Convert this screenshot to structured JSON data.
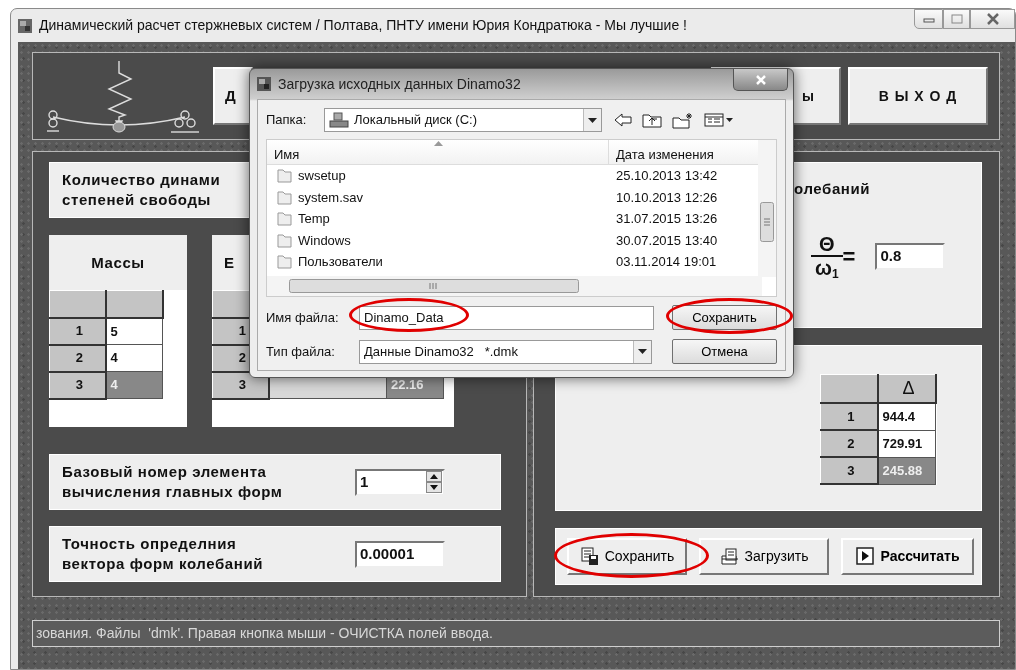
{
  "window": {
    "title": "Динамический расчет стержневых систем / Полтава, ПНТУ имени Юрия Кондратюка - Мы лучшие !"
  },
  "header": {
    "left_button": "Д",
    "middle_button": "ы",
    "exit_button": "В Ы Х О Д"
  },
  "dof": {
    "label_lines": [
      "Количество динами",
      "степеней свободы"
    ]
  },
  "masses": {
    "title": "Массы",
    "rows": [
      {
        "label": "1",
        "value": "5",
        "selected": false
      },
      {
        "label": "2",
        "value": "4",
        "selected": false
      },
      {
        "label": "3",
        "value": "4",
        "selected": true
      }
    ]
  },
  "second_table": {
    "title": "Е",
    "rows": [
      {
        "label": "1"
      },
      {
        "label": "2"
      },
      {
        "label": "3",
        "value": "22.16",
        "selected": true
      }
    ]
  },
  "base_element": {
    "label_lines": [
      "Базовый номер элемента",
      "вычисления главных форм"
    ],
    "value": "1"
  },
  "precision": {
    "label_lines": [
      "Точность определния",
      "вектора форм колебаний"
    ],
    "value": "0.00001"
  },
  "ratio": {
    "title": "олебаний",
    "numerator": "Θ",
    "denominator": "ω",
    "denominator_sub": "1",
    "equals": "=",
    "value": "0.8"
  },
  "deltas": {
    "header": "Δ",
    "rows": [
      {
        "label": "1",
        "value": "944.4",
        "selected": false
      },
      {
        "label": "2",
        "value": "729.91",
        "selected": false
      },
      {
        "label": "3",
        "value": "245.88",
        "selected": true
      }
    ]
  },
  "actions": [
    {
      "kind": "save",
      "label": "Сохранить"
    },
    {
      "kind": "load",
      "label": "Загрузить"
    },
    {
      "kind": "run",
      "label": "Рассчитать"
    }
  ],
  "status_bar": "зования. Файлы  'dmk'. Правая кнопка мыши - ОЧИСТКА полей ввода.",
  "dialog": {
    "title": "Загрузка исходных данных Dinamo32",
    "folder_label": "Папка:",
    "folder": "Локальный диск (C:)",
    "columns": [
      "Имя",
      "Дата изменения"
    ],
    "files": [
      {
        "name": "swsetup",
        "date": "25.10.2013 13:42"
      },
      {
        "name": "system.sav",
        "date": "10.10.2013 12:26"
      },
      {
        "name": "Temp",
        "date": "31.07.2015 13:26"
      },
      {
        "name": "Windows",
        "date": "30.07.2015 13:40"
      },
      {
        "name": "Пользователи",
        "date": "03.11.2014 19:01"
      }
    ],
    "filename_label": "Имя файла:",
    "filename": "Dinamo_Data",
    "type_label": "Тип файла:",
    "type": "Данные Dinamo32   *.dmk",
    "save_button": "Сохранить",
    "cancel_button": "Отмена"
  }
}
